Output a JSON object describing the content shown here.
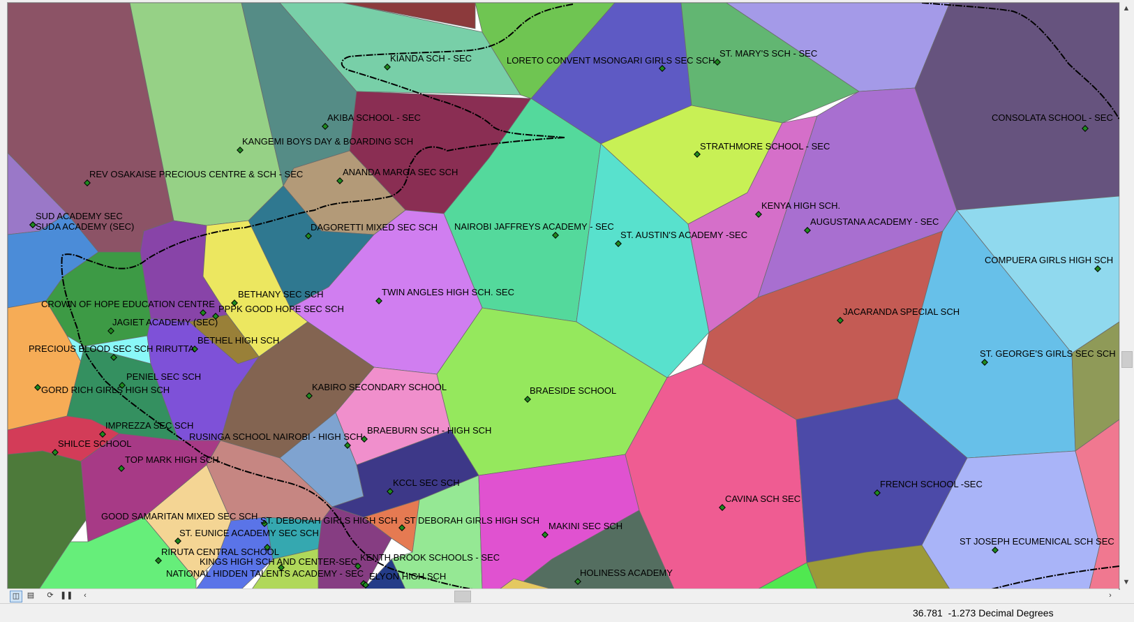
{
  "status": {
    "coords_x": "36.781",
    "coords_y": "-1.273",
    "coords_units": "Decimal Degrees"
  },
  "icons": {
    "data_view": "data-view-icon",
    "layout_view": "layout-view-icon",
    "refresh": "refresh-icon",
    "pause": "pause-drawing-icon",
    "scroll_left": "chevron-left-icon",
    "scroll_right": "chevron-right-icon",
    "scroll_up": "chevron-up-icon",
    "scroll_down": "chevron-down-icon"
  },
  "map": {
    "boundary_color": "#000000",
    "point_color": "#1f8a1f",
    "schools": [
      "KIANDA SCH - SEC",
      "LORETO CONVENT MSONGARI GIRLS SEC SCH",
      "ST. MARY'S SCH - SEC",
      "CONSOLATA  SCHOOL - SEC",
      "AKIBA SCHOOL - SEC",
      "KANGEMI BOYS DAY & BOARDING SCH",
      "STRATHMORE SCHOOL - SEC",
      "REV OSAKAISE PRECIOUS CENTRE & SCH - SEC",
      "ANANDA MARGA SEC SCH",
      "KENYA HIGH SCH.",
      "SUD ACADEMY SEC",
      "SUDA ACADEMY (SEC)",
      "AUGUSTANA ACADEMY - SEC",
      "DAGORETTI MIXED SEC SCH",
      "NAIROBI JAFFREYS  ACADEMY - SEC",
      "ST. AUSTIN'S ACADEMY -SEC",
      "COMPUERA GIRLS HIGH SCH",
      "TWIN ANGLES HIGH SCH. SEC",
      "BETHANY SEC SCH",
      "CROWN OF HOPE EDUCATION CENTRE",
      "PPPK GOOD HOPE SEC SCH",
      "JACARANDA SPECIAL SCH",
      "JAGIET ACADEMY (SEC)",
      "BETHEL HIGH SCH",
      "PRECIOUS BLOOD SEC SCH RIRUTTA",
      "ST. GEORGE'S GIRLS SEC SCH",
      "PENIEL SEC SCH",
      "GORD RICH  GIRLS HIGH SCH",
      "KABIRO SECONDARY SCHOOL",
      "BRAESIDE SCHOOL",
      "IMPREZZA SEC SCH",
      "BRAEBURN SCH - HIGH SCH",
      "RUSINGA SCHOOL NAIROBI - HIGH SCH",
      "SHILCE SCHOOL",
      "TOP MARK HIGH SCH",
      "KCCL SEC SCH",
      "FRENCH SCHOOL -SEC",
      "CAVINA SCH SEC",
      "GOOD SAMARITAN MIXED SEC SCH",
      "ST. DEBORAH GIRLS HIGH SCH",
      "ST DEBORAH GIRLS HIGH SCH",
      "MAKINI SEC SCH",
      "ST. EUNICE ACADEMY SEC SCH",
      "ST JOSEPH ECUMENICAL SCH SEC",
      "RIRUTA CENTRAL SCHOOL",
      "KINGS HIGH SCH AND CENTER-SEC",
      "KENTH BROOK SCHOOLS - SEC",
      "HOLINESS ACADEMY",
      "NATIONAL HIDDEN TALENTS ACADEMY - SEC",
      "ELYON HIGH SCH"
    ]
  }
}
